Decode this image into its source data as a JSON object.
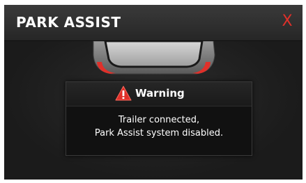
{
  "header": {
    "title": "PARK ASSIST",
    "close_symbol": "X"
  },
  "dialog": {
    "icon": "warning-triangle-icon",
    "title": "Warning",
    "message_line1": "Trailer connected,",
    "message_line2": "Park Assist system disabled."
  },
  "colors": {
    "accent_red": "#e0302a",
    "background": "#1e1e1e",
    "text": "#ffffff"
  }
}
